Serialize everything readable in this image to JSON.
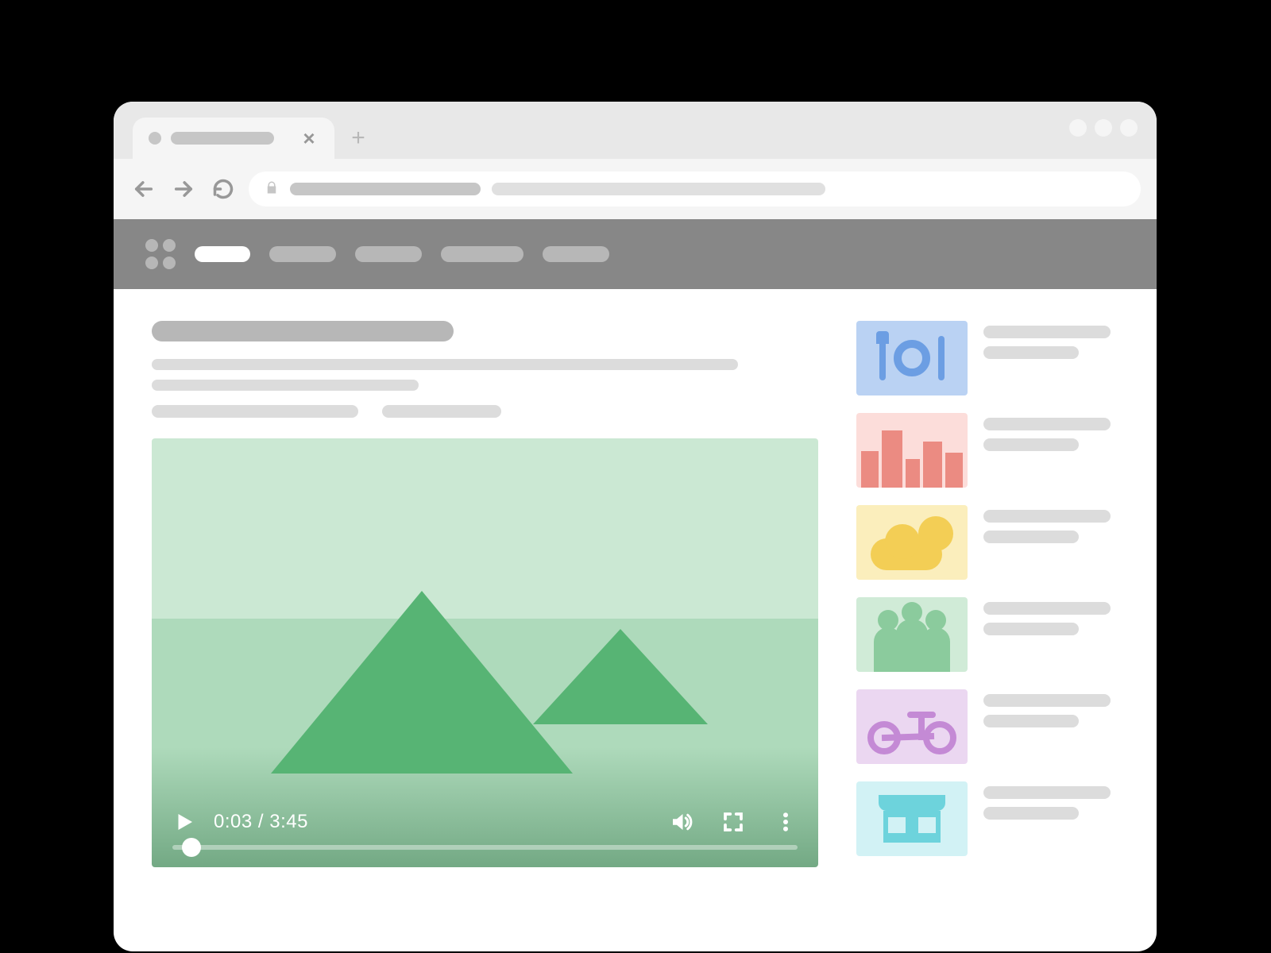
{
  "browser": {
    "tab_title": "",
    "address_segment_1": "",
    "address_segment_2": ""
  },
  "window_controls": [
    "minimize",
    "maximize",
    "close"
  ],
  "site_nav": {
    "items": [
      {
        "label": "",
        "active": true
      },
      {
        "label": "",
        "active": false
      },
      {
        "label": "",
        "active": false
      },
      {
        "label": "",
        "active": false
      },
      {
        "label": "",
        "active": false
      }
    ]
  },
  "article": {
    "title": "",
    "body_line_1": "",
    "body_line_2": "",
    "meta_1": "",
    "meta_2": ""
  },
  "video": {
    "current_time": "0:03",
    "duration": "3:45",
    "time_display": "0:03 / 3:45",
    "progress_percent": 3
  },
  "related": [
    {
      "icon": "food",
      "title": "",
      "subtitle": ""
    },
    {
      "icon": "city",
      "title": "",
      "subtitle": ""
    },
    {
      "icon": "weather",
      "title": "",
      "subtitle": ""
    },
    {
      "icon": "people",
      "title": "",
      "subtitle": ""
    },
    {
      "icon": "bike",
      "title": "",
      "subtitle": ""
    },
    {
      "icon": "shop",
      "title": "",
      "subtitle": ""
    }
  ],
  "colors": {
    "nav_bg": "#878787",
    "placeholder": "#C6C6C6",
    "video_green": "#57B474"
  }
}
